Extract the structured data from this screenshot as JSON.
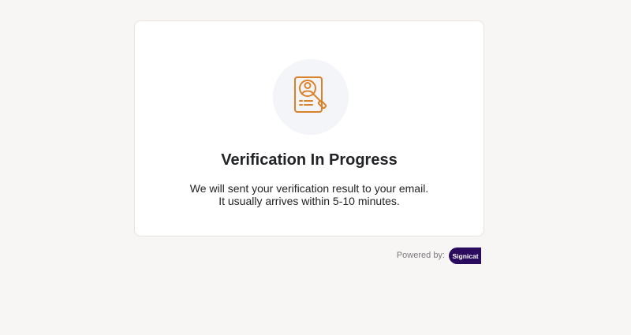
{
  "card": {
    "title": "Verification In Progress",
    "message_line1": "We will sent your verification result to your email.",
    "message_line2": "It usually arrives within 5-10 minutes.",
    "icon": "document-search-icon"
  },
  "footer": {
    "powered_label": "Powered by:",
    "brand_logo": "Signicat"
  },
  "colors": {
    "page_bg": "#f7f6f4",
    "icon_accent": "#d9822b",
    "icon_bg": "#f4f5f8",
    "brand": "#2b0b5e"
  }
}
